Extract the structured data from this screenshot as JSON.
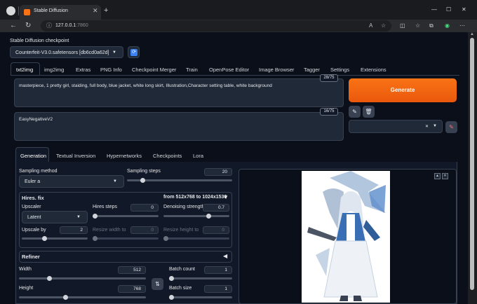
{
  "browser": {
    "tab_title": "Stable Diffusion",
    "tab_close": "✕",
    "new_tab": "+",
    "url_host": "127.0.0.1",
    "url_port": ":7860",
    "minimize": "—",
    "maximize": "☐",
    "close": "✕"
  },
  "checkpoint": {
    "label": "Stable Diffusion checkpoint",
    "value": "Counterfeit-V3.0.safetensors [db6cd0a62d]"
  },
  "main_tabs": [
    "txt2img",
    "img2img",
    "Extras",
    "PNG Info",
    "Checkpoint Merger",
    "Train",
    "OpenPose Editor",
    "Image Browser",
    "Tagger",
    "Settings",
    "Extensions"
  ],
  "prompt": {
    "positive": "masterpiece, 1 pretty girl, staiding, full body, blue jacket, white long skirt, Illustration,Character setting table, white background",
    "positive_count": "28/75",
    "negative": "EasyNegativeV2",
    "negative_count": "16/75"
  },
  "generate": {
    "label": "Generate"
  },
  "sub_tabs": [
    "Generation",
    "Textual Inversion",
    "Hypernetworks",
    "Checkpoints",
    "Lora"
  ],
  "generation": {
    "sampling_method_label": "Sampling method",
    "sampling_method_value": "Euler a",
    "sampling_steps_label": "Sampling steps",
    "sampling_steps_value": "20",
    "sampling_steps_fraction": 0.13,
    "hires": {
      "title": "Hires. fix",
      "resolution": "from 512x768  to 1024x1536",
      "upscaler_label": "Upscaler",
      "upscaler_value": "Latent",
      "hires_steps_label": "Hires steps",
      "hires_steps_value": "0",
      "hires_steps_fraction": 0.0,
      "denoise_label": "Denoising strength",
      "denoise_value": "0.7",
      "denoise_fraction": 0.7,
      "upscale_by_label": "Upscale by",
      "upscale_by_value": "2",
      "upscale_by_fraction": 0.33,
      "resize_w_label": "Resize width to",
      "resize_w_value": "0",
      "resize_h_label": "Resize height to",
      "resize_h_value": "0"
    },
    "refiner_title": "Refiner",
    "width_label": "Width",
    "width_value": "512",
    "width_fraction": 0.23,
    "height_label": "Height",
    "height_value": "768",
    "height_fraction": 0.36,
    "batch_count_label": "Batch count",
    "batch_count_value": "1",
    "batch_size_label": "Batch size",
    "batch_size_value": "1"
  },
  "accent_color": "#f97316"
}
